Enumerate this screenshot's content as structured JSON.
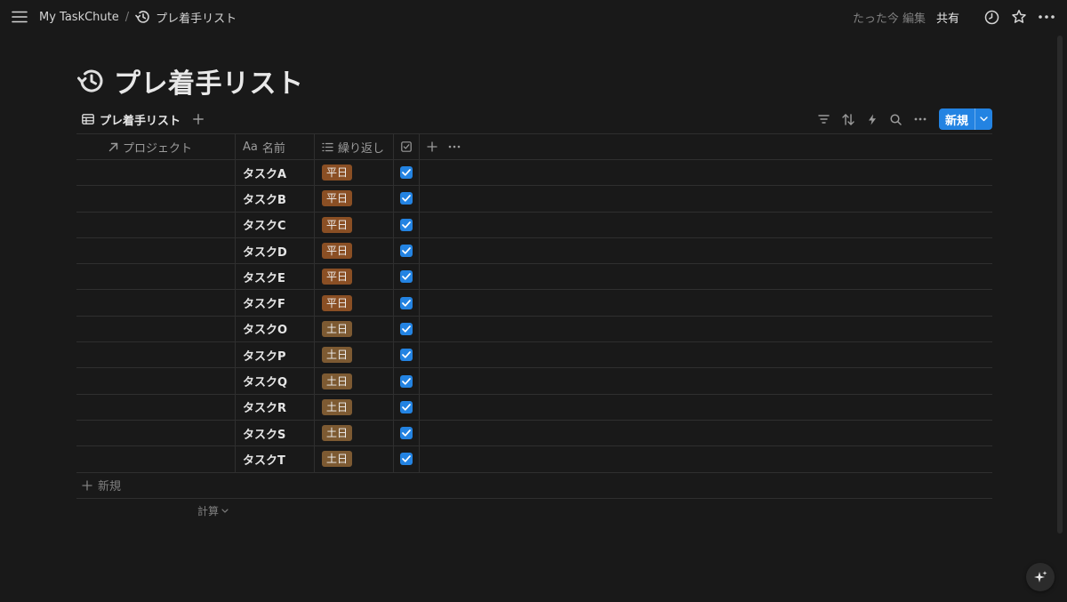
{
  "topbar": {
    "workspace": "My TaskChute",
    "separator": "/",
    "page": "プレ着手リスト",
    "edited": "たった今 編集",
    "share": "共有"
  },
  "page_title": "プレ着手リスト",
  "view": {
    "tab_label": "プレ着手リスト",
    "new_button": "新規"
  },
  "table": {
    "columns": {
      "project": "プロジェクト",
      "name_prefix": "Aa",
      "name": "名前",
      "repeat": "繰り返し"
    },
    "rows": [
      {
        "name": "タスクA",
        "repeat": "平日",
        "checked": true
      },
      {
        "name": "タスクB",
        "repeat": "平日",
        "checked": true
      },
      {
        "name": "タスクC",
        "repeat": "平日",
        "checked": true
      },
      {
        "name": "タスクD",
        "repeat": "平日",
        "checked": true
      },
      {
        "name": "タスクE",
        "repeat": "平日",
        "checked": true
      },
      {
        "name": "タスクF",
        "repeat": "平日",
        "checked": true
      },
      {
        "name": "タスクO",
        "repeat": "土日",
        "checked": true
      },
      {
        "name": "タスクP",
        "repeat": "土日",
        "checked": true
      },
      {
        "name": "タスクQ",
        "repeat": "土日",
        "checked": true
      },
      {
        "name": "タスクR",
        "repeat": "土日",
        "checked": true
      },
      {
        "name": "タスクS",
        "repeat": "土日",
        "checked": true
      },
      {
        "name": "タスクT",
        "repeat": "土日",
        "checked": true
      }
    ],
    "add_row": "新規",
    "calculate": "計算"
  },
  "colors": {
    "accent": "#2383e2",
    "tag_weekday": "#8a4f24",
    "tag_weekend": "#7d5a32",
    "background": "#191919"
  }
}
